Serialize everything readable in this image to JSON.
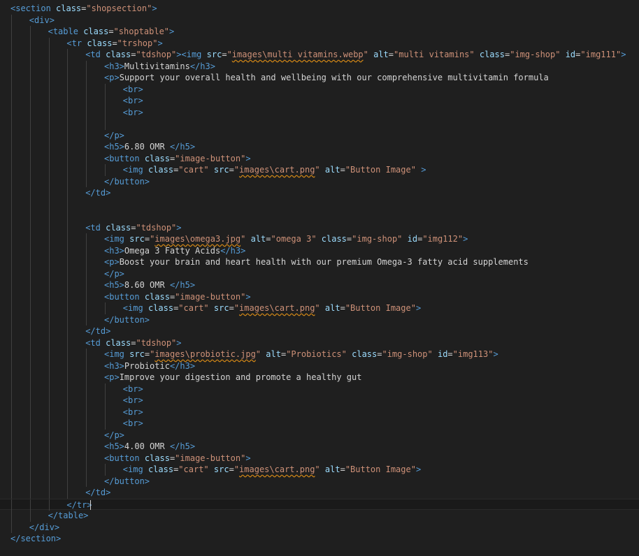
{
  "editor": {
    "language": "html",
    "colors": {
      "background": "#1f1f1f",
      "tag": "#569cd6",
      "attribute": "#9cdcfe",
      "string": "#ce9178",
      "text": "#d4d4d4",
      "warning_underline": "#d18616"
    },
    "lines": [
      {
        "indent": 0,
        "tokens": [
          [
            "tag",
            "<section"
          ],
          [
            "text",
            " "
          ],
          [
            "attr",
            "class"
          ],
          [
            "text",
            "="
          ],
          [
            "str",
            "\"shopsection\""
          ],
          [
            "tag",
            ">"
          ]
        ]
      },
      {
        "indent": 1,
        "tokens": [
          [
            "tag",
            "<div>"
          ]
        ]
      },
      {
        "indent": 2,
        "tokens": [
          [
            "tag",
            "<table"
          ],
          [
            "text",
            " "
          ],
          [
            "attr",
            "class"
          ],
          [
            "text",
            "="
          ],
          [
            "str",
            "\"shoptable\""
          ],
          [
            "tag",
            ">"
          ]
        ]
      },
      {
        "indent": 3,
        "tokens": [
          [
            "tag",
            "<tr"
          ],
          [
            "text",
            " "
          ],
          [
            "attr",
            "class"
          ],
          [
            "text",
            "="
          ],
          [
            "str",
            "\"trshop\""
          ],
          [
            "tag",
            ">"
          ]
        ]
      },
      {
        "indent": 4,
        "tokens": [
          [
            "tag",
            "<td"
          ],
          [
            "text",
            " "
          ],
          [
            "attr",
            "class"
          ],
          [
            "text",
            "="
          ],
          [
            "str",
            "\"tdshop\""
          ],
          [
            "tag",
            ">"
          ],
          [
            "tag",
            "<img"
          ],
          [
            "text",
            " "
          ],
          [
            "attr",
            "src"
          ],
          [
            "text",
            "="
          ],
          [
            "str",
            "\""
          ],
          [
            "link",
            "images\\multi vitamins.webp"
          ],
          [
            "str",
            "\""
          ],
          [
            "text",
            " "
          ],
          [
            "attr",
            "alt"
          ],
          [
            "text",
            "="
          ],
          [
            "str",
            "\"multi vitamins\""
          ],
          [
            "text",
            " "
          ],
          [
            "attr",
            "class"
          ],
          [
            "text",
            "="
          ],
          [
            "str",
            "\"img-shop\""
          ],
          [
            "text",
            " "
          ],
          [
            "attr",
            "id"
          ],
          [
            "text",
            "="
          ],
          [
            "str",
            "\"img111\""
          ],
          [
            "tag",
            ">"
          ]
        ]
      },
      {
        "indent": 5,
        "tokens": [
          [
            "tag",
            "<h3>"
          ],
          [
            "text",
            "Multivitamins"
          ],
          [
            "tag",
            "</h3>"
          ]
        ]
      },
      {
        "indent": 5,
        "tokens": [
          [
            "tag",
            "<p>"
          ],
          [
            "text",
            "Support your overall health and wellbeing with our comprehensive multivitamin formula"
          ]
        ]
      },
      {
        "indent": 6,
        "tokens": [
          [
            "tag",
            "<br>"
          ]
        ]
      },
      {
        "indent": 6,
        "tokens": [
          [
            "tag",
            "<br>"
          ]
        ]
      },
      {
        "indent": 6,
        "tokens": [
          [
            "tag",
            "<br>"
          ]
        ]
      },
      {
        "indent": 6,
        "tokens": []
      },
      {
        "indent": 5,
        "tokens": [
          [
            "tag",
            "</p>"
          ]
        ]
      },
      {
        "indent": 5,
        "tokens": [
          [
            "tag",
            "<h5>"
          ],
          [
            "text",
            "6.80 OMR "
          ],
          [
            "tag",
            "</h5>"
          ]
        ]
      },
      {
        "indent": 5,
        "tokens": [
          [
            "tag",
            "<button"
          ],
          [
            "text",
            " "
          ],
          [
            "attr",
            "class"
          ],
          [
            "text",
            "="
          ],
          [
            "str",
            "\"image-button\""
          ],
          [
            "tag",
            ">"
          ]
        ]
      },
      {
        "indent": 6,
        "tokens": [
          [
            "tag",
            "<img"
          ],
          [
            "text",
            " "
          ],
          [
            "attr",
            "class"
          ],
          [
            "text",
            "="
          ],
          [
            "str",
            "\"cart\""
          ],
          [
            "text",
            " "
          ],
          [
            "attr",
            "src"
          ],
          [
            "text",
            "="
          ],
          [
            "str",
            "\""
          ],
          [
            "link",
            "images\\cart.png"
          ],
          [
            "str",
            "\""
          ],
          [
            "text",
            " "
          ],
          [
            "attr",
            "alt"
          ],
          [
            "text",
            "="
          ],
          [
            "str",
            "\"Button Image\""
          ],
          [
            "text",
            " "
          ],
          [
            "tag",
            ">"
          ]
        ]
      },
      {
        "indent": 5,
        "tokens": [
          [
            "tag",
            "</button>"
          ]
        ]
      },
      {
        "indent": 4,
        "tokens": [
          [
            "tag",
            "</td>"
          ]
        ]
      },
      {
        "indent": 4,
        "tokens": []
      },
      {
        "indent": 4,
        "tokens": []
      },
      {
        "indent": 4,
        "tokens": [
          [
            "tag",
            "<td"
          ],
          [
            "text",
            " "
          ],
          [
            "attr",
            "class"
          ],
          [
            "text",
            "="
          ],
          [
            "str",
            "\"tdshop\""
          ],
          [
            "tag",
            ">"
          ]
        ]
      },
      {
        "indent": 5,
        "tokens": [
          [
            "tag",
            "<img"
          ],
          [
            "text",
            " "
          ],
          [
            "attr",
            "src"
          ],
          [
            "text",
            "="
          ],
          [
            "str",
            "\""
          ],
          [
            "link",
            "images\\omega3.jpg"
          ],
          [
            "str",
            "\""
          ],
          [
            "text",
            " "
          ],
          [
            "attr",
            "alt"
          ],
          [
            "text",
            "="
          ],
          [
            "str",
            "\"omega 3\""
          ],
          [
            "text",
            " "
          ],
          [
            "attr",
            "class"
          ],
          [
            "text",
            "="
          ],
          [
            "str",
            "\"img-shop\""
          ],
          [
            "text",
            " "
          ],
          [
            "attr",
            "id"
          ],
          [
            "text",
            "="
          ],
          [
            "str",
            "\"img112\""
          ],
          [
            "tag",
            ">"
          ]
        ]
      },
      {
        "indent": 5,
        "tokens": [
          [
            "tag",
            "<h3>"
          ],
          [
            "text",
            "Omega 3 Fatty Acids"
          ],
          [
            "tag",
            "</h3>"
          ]
        ]
      },
      {
        "indent": 5,
        "tokens": [
          [
            "tag",
            "<p>"
          ],
          [
            "text",
            "Boost your brain and heart health with our premium Omega-3 fatty acid supplements"
          ]
        ]
      },
      {
        "indent": 5,
        "tokens": [
          [
            "tag",
            "</p>"
          ]
        ]
      },
      {
        "indent": 5,
        "tokens": [
          [
            "tag",
            "<h5>"
          ],
          [
            "text",
            "8.60 OMR "
          ],
          [
            "tag",
            "</h5>"
          ]
        ]
      },
      {
        "indent": 5,
        "tokens": [
          [
            "tag",
            "<button"
          ],
          [
            "text",
            " "
          ],
          [
            "attr",
            "class"
          ],
          [
            "text",
            "="
          ],
          [
            "str",
            "\"image-button\""
          ],
          [
            "tag",
            ">"
          ]
        ]
      },
      {
        "indent": 6,
        "tokens": [
          [
            "tag",
            "<img"
          ],
          [
            "text",
            " "
          ],
          [
            "attr",
            "class"
          ],
          [
            "text",
            "="
          ],
          [
            "str",
            "\"cart\""
          ],
          [
            "text",
            " "
          ],
          [
            "attr",
            "src"
          ],
          [
            "text",
            "="
          ],
          [
            "str",
            "\""
          ],
          [
            "link",
            "images\\cart.png"
          ],
          [
            "str",
            "\""
          ],
          [
            "text",
            " "
          ],
          [
            "attr",
            "alt"
          ],
          [
            "text",
            "="
          ],
          [
            "str",
            "\"Button Image\""
          ],
          [
            "tag",
            ">"
          ]
        ]
      },
      {
        "indent": 5,
        "tokens": [
          [
            "tag",
            "</button>"
          ]
        ]
      },
      {
        "indent": 4,
        "tokens": [
          [
            "tag",
            "</td>"
          ]
        ]
      },
      {
        "indent": 4,
        "tokens": [
          [
            "tag",
            "<td"
          ],
          [
            "text",
            " "
          ],
          [
            "attr",
            "class"
          ],
          [
            "text",
            "="
          ],
          [
            "str",
            "\"tdshop\""
          ],
          [
            "tag",
            ">"
          ]
        ]
      },
      {
        "indent": 5,
        "tokens": [
          [
            "tag",
            "<img"
          ],
          [
            "text",
            " "
          ],
          [
            "attr",
            "src"
          ],
          [
            "text",
            "="
          ],
          [
            "str",
            "\""
          ],
          [
            "link",
            "images\\probiotic.jpg"
          ],
          [
            "str",
            "\""
          ],
          [
            "text",
            " "
          ],
          [
            "attr",
            "alt"
          ],
          [
            "text",
            "="
          ],
          [
            "str",
            "\"Probiotics\""
          ],
          [
            "text",
            " "
          ],
          [
            "attr",
            "class"
          ],
          [
            "text",
            "="
          ],
          [
            "str",
            "\"img-shop\""
          ],
          [
            "text",
            " "
          ],
          [
            "attr",
            "id"
          ],
          [
            "text",
            "="
          ],
          [
            "str",
            "\"img113\""
          ],
          [
            "tag",
            ">"
          ]
        ]
      },
      {
        "indent": 5,
        "tokens": [
          [
            "tag",
            "<h3>"
          ],
          [
            "text",
            "Probiotic"
          ],
          [
            "tag",
            "</h3>"
          ]
        ]
      },
      {
        "indent": 5,
        "tokens": [
          [
            "tag",
            "<p>"
          ],
          [
            "text",
            "Improve your digestion and promote a healthy gut"
          ]
        ]
      },
      {
        "indent": 6,
        "tokens": [
          [
            "tag",
            "<br>"
          ]
        ]
      },
      {
        "indent": 6,
        "tokens": [
          [
            "tag",
            "<br>"
          ]
        ]
      },
      {
        "indent": 6,
        "tokens": [
          [
            "tag",
            "<br>"
          ]
        ]
      },
      {
        "indent": 6,
        "tokens": [
          [
            "tag",
            "<br>"
          ]
        ]
      },
      {
        "indent": 5,
        "tokens": [
          [
            "tag",
            "</p>"
          ]
        ]
      },
      {
        "indent": 5,
        "tokens": [
          [
            "tag",
            "<h5>"
          ],
          [
            "text",
            "4.00 OMR "
          ],
          [
            "tag",
            "</h5>"
          ]
        ]
      },
      {
        "indent": 5,
        "tokens": [
          [
            "tag",
            "<button"
          ],
          [
            "text",
            " "
          ],
          [
            "attr",
            "class"
          ],
          [
            "text",
            "="
          ],
          [
            "str",
            "\"image-button\""
          ],
          [
            "tag",
            ">"
          ]
        ]
      },
      {
        "indent": 6,
        "tokens": [
          [
            "tag",
            "<img"
          ],
          [
            "text",
            " "
          ],
          [
            "attr",
            "class"
          ],
          [
            "text",
            "="
          ],
          [
            "str",
            "\"cart\""
          ],
          [
            "text",
            " "
          ],
          [
            "attr",
            "src"
          ],
          [
            "text",
            "="
          ],
          [
            "str",
            "\""
          ],
          [
            "link",
            "images\\cart.png"
          ],
          [
            "str",
            "\""
          ],
          [
            "text",
            " "
          ],
          [
            "attr",
            "alt"
          ],
          [
            "text",
            "="
          ],
          [
            "str",
            "\"Button Image\""
          ],
          [
            "tag",
            ">"
          ]
        ]
      },
      {
        "indent": 5,
        "tokens": [
          [
            "tag",
            "</button>"
          ]
        ]
      },
      {
        "indent": 4,
        "tokens": [
          [
            "tag",
            "</td>"
          ]
        ]
      },
      {
        "indent": 3,
        "tokens": [
          [
            "tag",
            "</tr>"
          ]
        ],
        "current": true
      },
      {
        "indent": 2,
        "tokens": [
          [
            "tag",
            "</table>"
          ]
        ]
      },
      {
        "indent": 1,
        "tokens": [
          [
            "tag",
            "</div>"
          ]
        ]
      },
      {
        "indent": 0,
        "tokens": [
          [
            "tag",
            "</section>"
          ]
        ]
      }
    ]
  }
}
